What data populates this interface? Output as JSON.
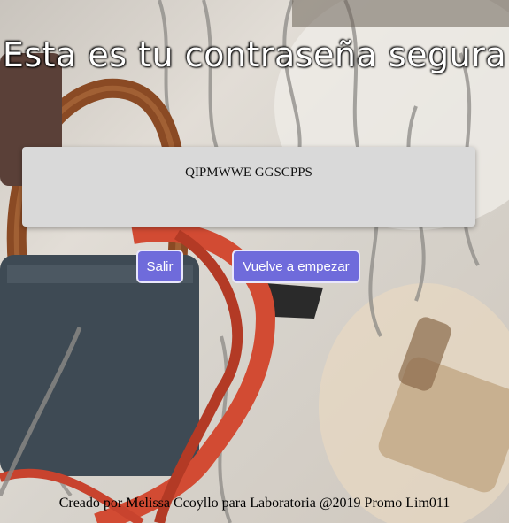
{
  "page": {
    "title": "Esta es tu contraseña segura",
    "password": "QIPMWWE GGSCPPS",
    "buttons": {
      "exit_label": "Salir",
      "restart_label": "Vuelve a empezar"
    },
    "footer": "Creado por Melissa Ccoyllo para Laboratoria @2019 Promo Lim011"
  },
  "colors": {
    "button_bg": "#6f6bdb",
    "card_bg": "#d9d9d9",
    "padlock": "#3e4a54",
    "ribbon": "#d24b33",
    "rust": "#8a4a24"
  }
}
